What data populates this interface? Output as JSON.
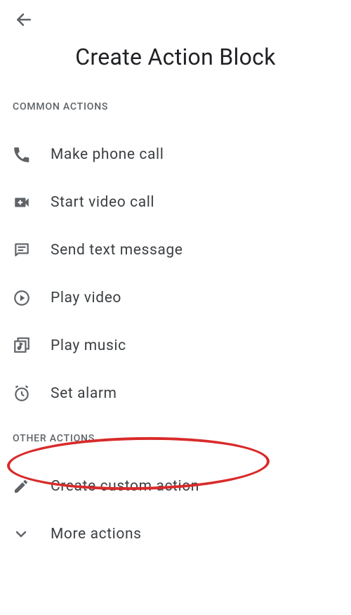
{
  "title": "Create Action Block",
  "sections": {
    "common": {
      "label": "COMMON ACTIONS",
      "items": [
        {
          "label": "Make phone call"
        },
        {
          "label": "Start video call"
        },
        {
          "label": "Send text message"
        },
        {
          "label": "Play video"
        },
        {
          "label": "Play music"
        },
        {
          "label": "Set alarm"
        }
      ]
    },
    "other": {
      "label": "OTHER ACTIONS",
      "items": [
        {
          "label": "Create custom action"
        },
        {
          "label": "More actions"
        }
      ]
    }
  }
}
